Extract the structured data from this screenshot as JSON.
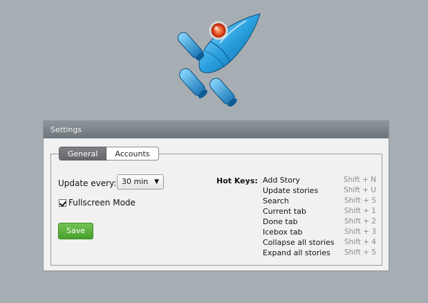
{
  "panel": {
    "title": "Settings"
  },
  "tabs": [
    {
      "label": "General",
      "active": true
    },
    {
      "label": "Accounts",
      "active": false
    }
  ],
  "general": {
    "update_label": "Update every:",
    "update_value": "30 min",
    "fullscreen_label": "Fullscreen Mode",
    "fullscreen_checked": true,
    "save_label": "Save"
  },
  "hotkeys": {
    "title": "Hot Keys:",
    "items": [
      {
        "action": "Add Story",
        "key": "Shift + N"
      },
      {
        "action": "Update stories",
        "key": "Shift + U"
      },
      {
        "action": "Search",
        "key": "Shift + S"
      },
      {
        "action": "Current tab",
        "key": "Shift + 1"
      },
      {
        "action": "Done tab",
        "key": "Shift + 2"
      },
      {
        "action": "Icebox tab",
        "key": "Shift + 3"
      },
      {
        "action": "Collapse all stories",
        "key": "Shift + 4"
      },
      {
        "action": "Expand all stories",
        "key": "Shift + 5"
      }
    ]
  },
  "icons": {
    "logo": "rocket-icon",
    "select_arrow": "triangle-down-icon",
    "checkbox": "checkmark-icon"
  },
  "colors": {
    "background": "#a7aeb3",
    "save_button": "#5cb23f",
    "header": "#7b8389"
  }
}
